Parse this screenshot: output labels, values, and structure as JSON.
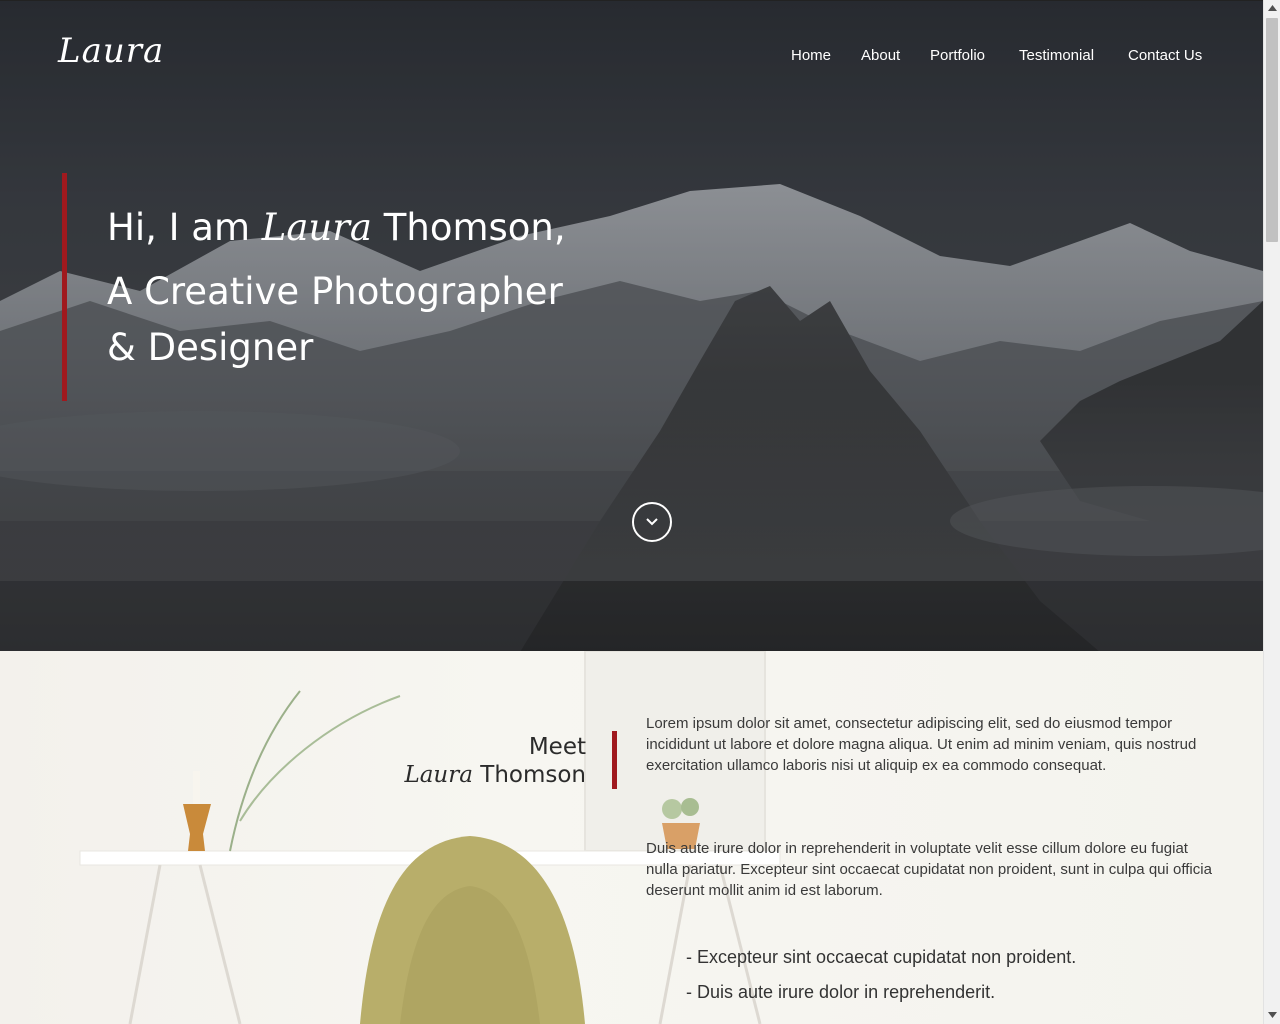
{
  "brand": {
    "logo": "Laura"
  },
  "nav": {
    "items": [
      "Home",
      "About",
      "Portfolio",
      "Testimonial",
      "Contact Us"
    ]
  },
  "hero": {
    "line1_prefix": "Hi, I am ",
    "line1_script": "Laura",
    "line1_suffix": " Thomson,",
    "line2": "A Creative Photographer",
    "line3": "& Designer",
    "scroll_icon": "chevron-down-icon"
  },
  "about": {
    "meet": "Meet",
    "name_script": "Laura",
    "name_rest": " Thomson",
    "paragraph1": "Lorem ipsum dolor sit amet, consectetur adipiscing elit, sed do eiusmod tempor incididunt ut labore et dolore magna aliqua. Ut enim ad minim veniam, quis nostrud exercitation ullamco laboris nisi ut aliquip ex ea commodo consequat.",
    "paragraph2": "Duis aute irure dolor in reprehenderit in voluptate velit esse cillum dolore eu fugiat nulla pariatur. Excepteur sint occaecat cupidatat non proident, sunt in culpa qui officia deserunt mollit anim id est laborum.",
    "bullets": [
      "- Excepteur sint occaecat cupidatat non proident.",
      "- Duis aute irure dolor in reprehenderit."
    ]
  },
  "colors": {
    "accent": "#a0191e",
    "hero_text": "#ffffff",
    "body_text": "#3a3a3a"
  }
}
